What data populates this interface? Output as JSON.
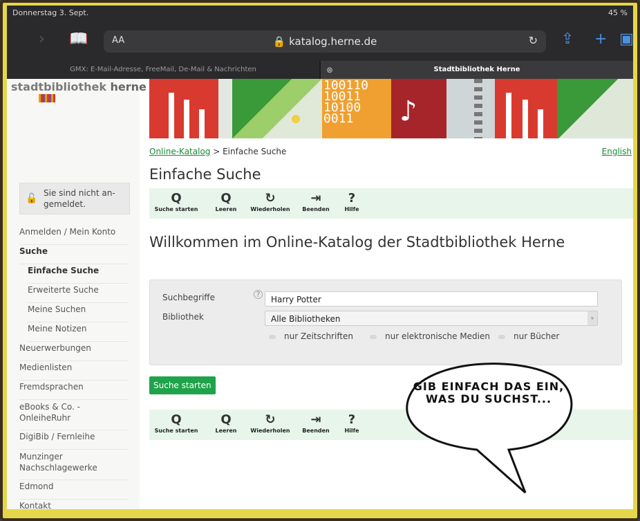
{
  "status": {
    "date": "Donnerstag 3. Sept.",
    "battery": "45 %"
  },
  "safari": {
    "text_size": "AA",
    "url": "katalog.herne.de"
  },
  "tabs": [
    {
      "label": "GMX: E-Mail-Adresse, FreeMail, De-Mail & Nachrichten"
    },
    {
      "label": "Stadtbibliothek Herne"
    }
  ],
  "logo": {
    "part1": "stadtbibliothek",
    "part2": "herne"
  },
  "banner": {
    "digits": "100110\n10011\n10100\n0011"
  },
  "breadcrumb": {
    "link": "Online-Katalog",
    "sep": " > ",
    "current": "Einfache Suche"
  },
  "lang_link": "English",
  "page_title": "Einfache Suche",
  "iconbar": [
    {
      "icon": "search-icon",
      "glyph": "Q",
      "label": "Suche starten"
    },
    {
      "icon": "zoom-out-icon",
      "glyph": "Q",
      "label": "Leeren"
    },
    {
      "icon": "refresh-icon",
      "glyph": "↻",
      "label": "Wiederholen"
    },
    {
      "icon": "exit-icon",
      "glyph": "⇥",
      "label": "Beenden"
    },
    {
      "icon": "help-icon",
      "glyph": "?",
      "label": "Hilfe"
    }
  ],
  "welcome": "Willkommen im Online-Katalog der Stadtbibliothek Herne",
  "form": {
    "search_label": "Suchbegriffe",
    "search_value": "Harry Potter",
    "library_label": "Bibliothek",
    "library_value": "Alle Bibliotheken",
    "filters": [
      "nur Zeitschriften",
      "nur elektronische Medien",
      "nur Bücher"
    ]
  },
  "search_button": "Suche starten",
  "sidebar": {
    "login_text": "Sie sind nicht an-gemeldet.",
    "items": [
      {
        "label": "Anmelden / Mein Konto",
        "level": 0,
        "bold": false
      },
      {
        "label": "Suche",
        "level": 0,
        "bold": true
      },
      {
        "label": "Einfache Suche",
        "level": 1,
        "bold": true
      },
      {
        "label": "Erweiterte Suche",
        "level": 1,
        "bold": false
      },
      {
        "label": "Meine Suchen",
        "level": 1,
        "bold": false
      },
      {
        "label": "Meine Notizen",
        "level": 1,
        "bold": false
      },
      {
        "label": "Neuerwerbungen",
        "level": 0,
        "bold": false
      },
      {
        "label": "Medienlisten",
        "level": 0,
        "bold": false
      },
      {
        "label": "Fremdsprachen",
        "level": 0,
        "bold": false
      },
      {
        "label": "eBooks & Co. - OnleiheRuhr",
        "level": 0,
        "bold": false
      },
      {
        "label": "DigiBib / Fernleihe",
        "level": 0,
        "bold": false
      },
      {
        "label": "Munzinger Nachschlagewerke",
        "level": 0,
        "bold": false
      },
      {
        "label": "Edmond",
        "level": 0,
        "bold": false
      },
      {
        "label": "Kontakt",
        "level": 0,
        "bold": false
      }
    ]
  },
  "speech_bubble": "GIB EINFACH DAS EIN, WAS DU SUCHST...",
  "colors": {
    "accent_green": "#1ea34a",
    "frame_yellow": "#e5d74a",
    "safari_blue": "#4a90e2"
  }
}
